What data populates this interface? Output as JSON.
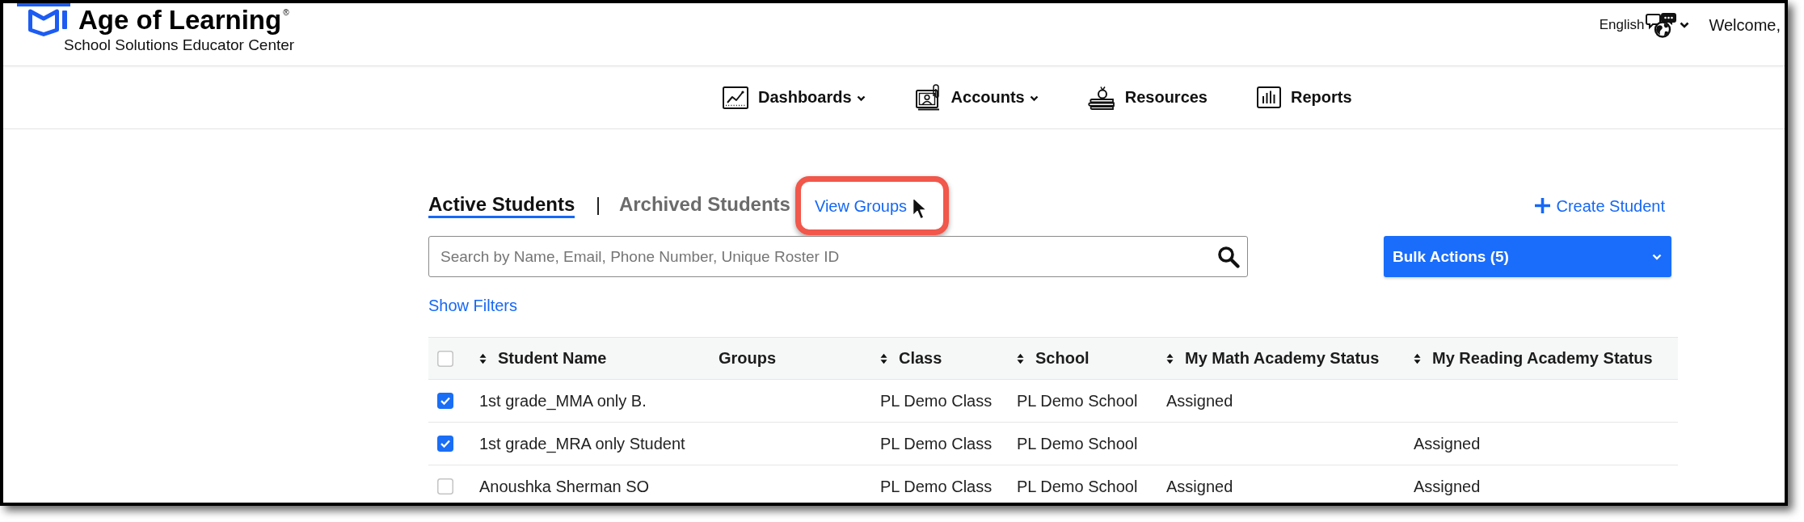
{
  "header": {
    "logo": {
      "title": "Age of Learning$^{®}$",
      "subtitle": "School Solutions Educator Center"
    },
    "language": {
      "label": "English"
    },
    "welcome": "Welcome,"
  },
  "nav": [
    {
      "label": "Dashboards",
      "has_menu": true
    },
    {
      "label": "Accounts",
      "has_menu": true
    },
    {
      "label": "Resources",
      "has_menu": false
    },
    {
      "label": "Reports",
      "has_menu": false
    }
  ],
  "students": {
    "tabs": [
      {
        "label": "Active Students",
        "selected": true
      },
      {
        "label": "Archived Students",
        "selected": false
      }
    ],
    "view_groups": {
      "label": "View Groups",
      "highlighted": true,
      "hovered": true
    },
    "create_student": {
      "label": "Create Student"
    },
    "search": {
      "placeholder": "Search by Name, Email, Phone Number, Unique Roster ID"
    },
    "bulk_actions": {
      "label": "Bulk Actions (5)"
    },
    "show_filters": {
      "label": "Show Filters"
    }
  },
  "table": {
    "select_all": {
      "checked": false
    },
    "columns": [
      {
        "label": "Student Name",
        "sortable": true
      },
      {
        "label": "Groups",
        "sortable": false
      },
      {
        "label": "Class",
        "sortable": true
      },
      {
        "label": "School",
        "sortable": true
      },
      {
        "label": "My Math Academy Status",
        "sortable": true
      },
      {
        "label": "My Reading Academy Status",
        "sortable": true
      }
    ],
    "rows": [
      {
        "checked": true,
        "student_name": "1st grade_MMA only B.",
        "class": "PL Demo Class",
        "school": "PL Demo School",
        "my_math_academy_status": "Assigned"
      },
      {
        "checked": true,
        "student_name": "1st grade_MRA only Student",
        "class": "PL Demo Class",
        "school": "PL Demo School",
        "my_reading_academy_status": "Assigned"
      },
      {
        "checked": false,
        "student_name": "Anoushka Sherman SO",
        "class": "PL Demo Class",
        "school": "PL Demo School",
        "my_math_academy_status": "Assigned",
        "my_reading_academy_status": "Assigned"
      }
    ]
  }
}
